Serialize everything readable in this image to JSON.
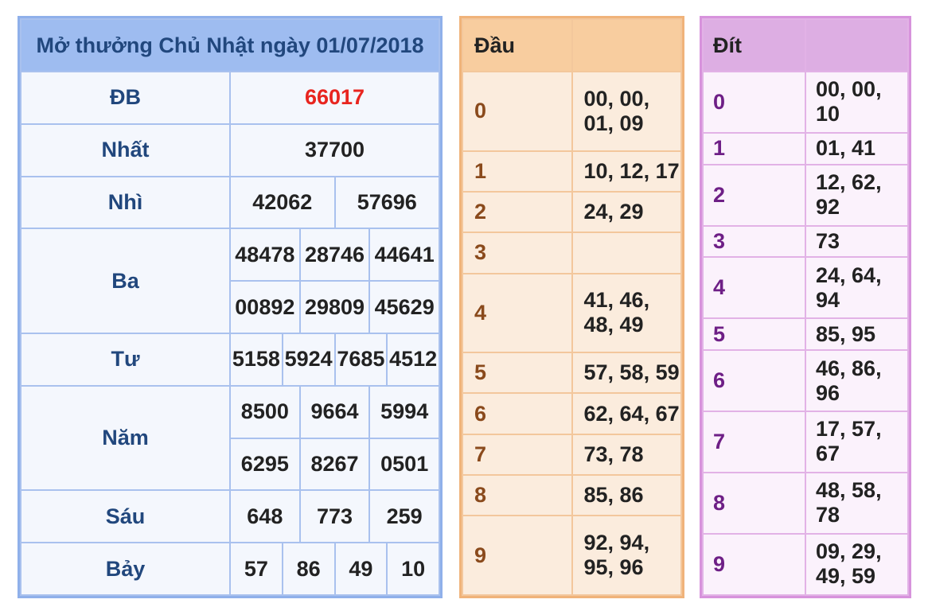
{
  "results": {
    "title": "Mở thưởng Chủ Nhật ngày 01/07/2018",
    "rows": {
      "db": {
        "label": "ĐB",
        "values": [
          "66017"
        ]
      },
      "nhat": {
        "label": "Nhất",
        "values": [
          "37700"
        ]
      },
      "nhi": {
        "label": "Nhì",
        "values": [
          "42062",
          "57696"
        ]
      },
      "ba": {
        "label": "Ba",
        "values": [
          "48478",
          "28746",
          "44641",
          "00892",
          "29809",
          "45629"
        ]
      },
      "tu": {
        "label": "Tư",
        "values": [
          "5158",
          "5924",
          "7685",
          "4512"
        ]
      },
      "nam": {
        "label": "Năm",
        "values": [
          "8500",
          "9664",
          "5994",
          "6295",
          "8267",
          "0501"
        ]
      },
      "sau": {
        "label": "Sáu",
        "values": [
          "648",
          "773",
          "259"
        ]
      },
      "bay": {
        "label": "Bảy",
        "values": [
          "57",
          "86",
          "49",
          "10"
        ]
      }
    },
    "special_color": "#e8251f"
  },
  "dau": {
    "header": "Đầu",
    "rows": [
      {
        "k": "0",
        "v": "00, 00, 01, 09"
      },
      {
        "k": "1",
        "v": "10, 12, 17"
      },
      {
        "k": "2",
        "v": "24, 29"
      },
      {
        "k": "3",
        "v": ""
      },
      {
        "k": "4",
        "v": "41, 46, 48, 49"
      },
      {
        "k": "5",
        "v": "57, 58, 59"
      },
      {
        "k": "6",
        "v": "62, 64, 67"
      },
      {
        "k": "7",
        "v": "73, 78"
      },
      {
        "k": "8",
        "v": "85, 86"
      },
      {
        "k": "9",
        "v": "92, 94, 95, 96"
      }
    ]
  },
  "dit": {
    "header": "Đít",
    "rows": [
      {
        "k": "0",
        "v": "00, 00, 10"
      },
      {
        "k": "1",
        "v": "01, 41"
      },
      {
        "k": "2",
        "v": "12, 62, 92"
      },
      {
        "k": "3",
        "v": "73"
      },
      {
        "k": "4",
        "v": "24, 64, 94"
      },
      {
        "k": "5",
        "v": "85, 95"
      },
      {
        "k": "6",
        "v": "46, 86, 96"
      },
      {
        "k": "7",
        "v": "17, 57, 67"
      },
      {
        "k": "8",
        "v": "48, 58, 78"
      },
      {
        "k": "9",
        "v": "09, 29, 49, 59"
      }
    ]
  }
}
